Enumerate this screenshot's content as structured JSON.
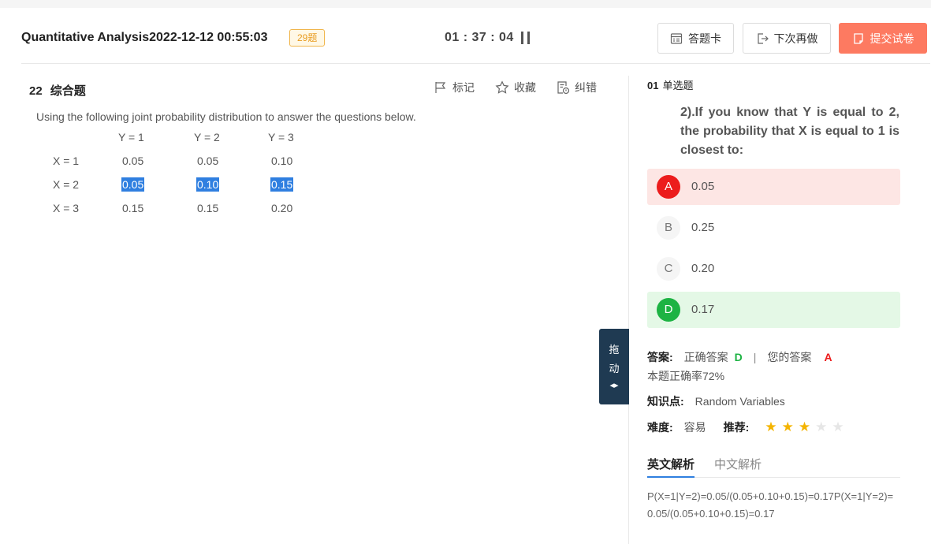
{
  "header": {
    "title": "Quantitative Analysis2022-12-12 00:55:03",
    "count_badge": "29题",
    "timer": "01 : 37 : 04",
    "buttons": {
      "answer_card": "答题卡",
      "do_later": "下次再做",
      "submit": "提交试卷"
    }
  },
  "question": {
    "number": "22",
    "type": "综合题",
    "tools": {
      "mark": "标记",
      "favorite": "收藏",
      "report": "纠错"
    },
    "stem": "Using the following joint probability distribution to answer the questions below.",
    "table": {
      "col_headers": [
        "Y = 1",
        "Y = 2",
        "Y = 3"
      ],
      "rows": [
        {
          "label": "X = 1",
          "values": [
            "0.05",
            "0.05",
            "0.10"
          ]
        },
        {
          "label": "X = 2",
          "values": [
            "0.05",
            "0.10",
            "0.15"
          ]
        },
        {
          "label": "X = 3",
          "values": [
            "0.15",
            "0.15",
            "0.20"
          ]
        }
      ]
    }
  },
  "drag_handle": {
    "line1": "拖",
    "line2": "动",
    "arrow": "◂▸"
  },
  "subquestion": {
    "index": "01",
    "type": "单选题",
    "text": "2).If you know that Y is equal to 2, the probability that X is equal to 1 is closest to:",
    "options": [
      {
        "letter": "A",
        "text": "0.05"
      },
      {
        "letter": "B",
        "text": "0.25"
      },
      {
        "letter": "C",
        "text": "0.20"
      },
      {
        "letter": "D",
        "text": "0.17"
      }
    ]
  },
  "answer": {
    "label": "答案:",
    "correct_label": "正确答案",
    "correct_value": "D",
    "separator": "|",
    "your_label": "您的答案",
    "your_value": "A",
    "accuracy": "本题正确率72%"
  },
  "knowledge": {
    "label": "知识点:",
    "value": "Random Variables"
  },
  "difficulty": {
    "label": "难度:",
    "value": "容易",
    "recommend_label": "推荐:",
    "stars": 3,
    "stars_max": 5
  },
  "analysis": {
    "tab_en": "英文解析",
    "tab_cn": "中文解析",
    "text": "P(X=1|Y=2)=0.05/(0.05+0.10+0.15)=0.17P(X=1|Y=2)=0.05/(0.05+0.10+0.15)=0.17"
  },
  "colors": {
    "submit_bg": "#fd7a61",
    "wrong_bg": "#fde6e4",
    "correct_bg": "#e4f8e6",
    "wrong": "#ec1c1c",
    "correct": "#1db343",
    "star_on": "#f4b400",
    "selection": "#2f7fe0",
    "drag_handle": "#1f3a52"
  }
}
